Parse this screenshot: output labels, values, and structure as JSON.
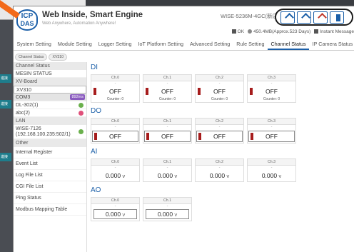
{
  "background": {
    "tags": [
      "進接",
      "進接",
      "進接"
    ]
  },
  "header": {
    "logo_line1": "ICP",
    "logo_line2": "DAS",
    "title": "Web Inside, Smart Engine",
    "subtitle": "Web Anywhere, Automation Anywhere!",
    "model": "WISE-5236M-4GC(新店)",
    "status_ok": "OK",
    "storage": "450.4MB(Approx.523 Days)",
    "instant_message": "Instant Message"
  },
  "nav": {
    "tabs": [
      "System Setting",
      "Module Setting",
      "Logger Setting",
      "IoT Platform Setting",
      "Advanced Setting",
      "Rule Setting",
      "Channel Status",
      "IP Camera Status"
    ],
    "active_index": 6
  },
  "breadcrumb": [
    "Channel Status",
    "XV310"
  ],
  "sidebar": {
    "items": [
      {
        "label": "Channel Status",
        "kind": "head"
      },
      {
        "label": "MESIN STATUS",
        "kind": "item"
      },
      {
        "label": "XV-Board",
        "kind": "head"
      },
      {
        "label": "XV310",
        "kind": "selected"
      },
      {
        "label": "COM3",
        "kind": "selected2",
        "badge": "892ms"
      },
      {
        "label": "DL-302(1)",
        "kind": "item",
        "dot": "#6ab04c"
      },
      {
        "label": "abc(2)",
        "kind": "item",
        "dot": "#e0507a"
      },
      {
        "label": "LAN",
        "kind": "head"
      },
      {
        "label": "WISE-7126",
        "label2": "(192.168.100.235:502/1)",
        "kind": "tall",
        "dot": "#6ab04c"
      },
      {
        "label": "Other",
        "kind": "head"
      },
      {
        "label": "Internal Register",
        "kind": "spaced"
      },
      {
        "label": "Event List",
        "kind": "spaced"
      },
      {
        "label": "Log File List",
        "kind": "spaced"
      },
      {
        "label": "CGI File List",
        "kind": "spaced"
      },
      {
        "label": "Ping Status",
        "kind": "spaced"
      },
      {
        "label": "Modbus Mapping Table",
        "kind": "spaced"
      }
    ]
  },
  "di": {
    "title": "DI",
    "channels": [
      {
        "name": "Ch.0",
        "dash": "-",
        "state": "OFF",
        "counter": "Counter: 0"
      },
      {
        "name": "Ch.1",
        "dash": "-",
        "state": "OFF",
        "counter": "Counter: 0"
      },
      {
        "name": "Ch.2",
        "dash": "-",
        "state": "OFF",
        "counter": "Counter: 0"
      },
      {
        "name": "Ch.3",
        "dash": "-",
        "state": "OFF",
        "counter": "Counter: 0"
      }
    ]
  },
  "do": {
    "title": "DO",
    "channels": [
      {
        "name": "Ch.0",
        "dash": "-",
        "state": "OFF"
      },
      {
        "name": "Ch.1",
        "dash": "-",
        "state": "OFF"
      },
      {
        "name": "Ch.2",
        "dash": "-",
        "state": "OFF"
      },
      {
        "name": "Ch.3",
        "dash": "-",
        "state": "OFF"
      }
    ]
  },
  "ai": {
    "title": "AI",
    "channels": [
      {
        "name": "Ch.0",
        "dash": "-",
        "value": "0.000",
        "unit": "V"
      },
      {
        "name": "Ch.1",
        "dash": "-",
        "value": "0.000",
        "unit": "V"
      },
      {
        "name": "Ch.2",
        "dash": "-",
        "value": "0.000",
        "unit": "V"
      },
      {
        "name": "Ch.3",
        "dash": "-",
        "value": "0.000",
        "unit": "V"
      }
    ]
  },
  "ao": {
    "title": "AO",
    "channels": [
      {
        "name": "Ch.0",
        "dash": "-",
        "value": "0.000",
        "unit": "V"
      },
      {
        "name": "Ch.1",
        "dash": "-",
        "value": "0.000",
        "unit": "V"
      }
    ]
  },
  "colors": {
    "accent": "#1b5fa8",
    "indicator_off": "#a61c1c",
    "annotation_arrow": "#f26a1b",
    "badge": "#8a5bbf"
  }
}
